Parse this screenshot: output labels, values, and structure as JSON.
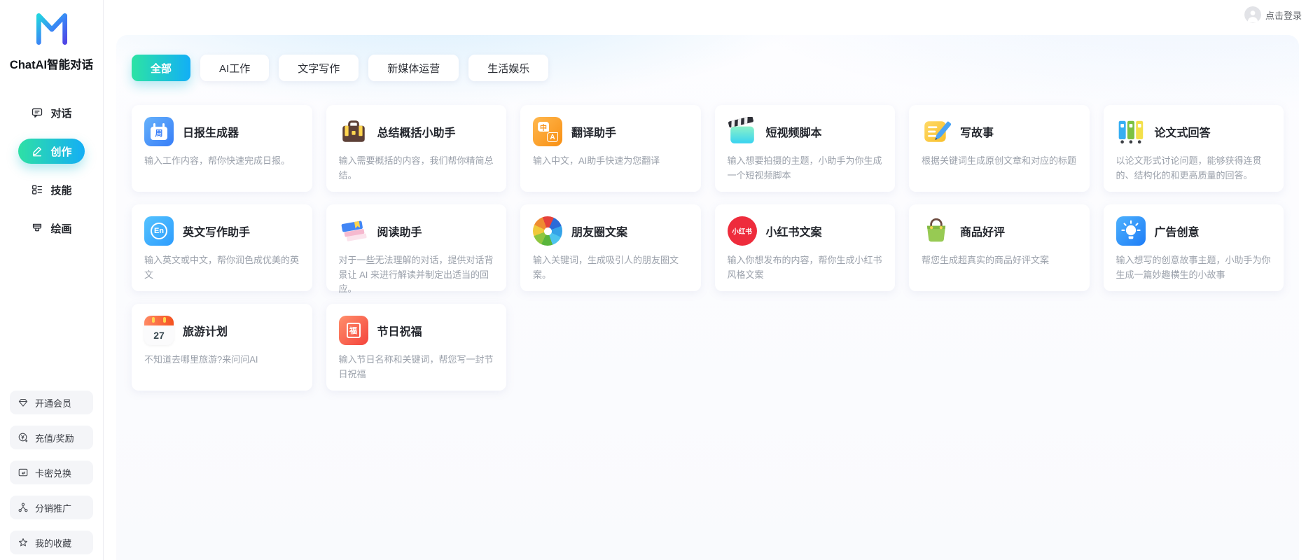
{
  "app": {
    "name": "ChatAI智能对话"
  },
  "header": {
    "login": "点击登录"
  },
  "sidebar": {
    "nav": [
      {
        "label": "对话",
        "active": false
      },
      {
        "label": "创作",
        "active": true
      },
      {
        "label": "技能",
        "active": false
      },
      {
        "label": "绘画",
        "active": false
      }
    ],
    "footer": [
      {
        "label": "开通会员"
      },
      {
        "label": "充值/奖励"
      },
      {
        "label": "卡密兑换"
      },
      {
        "label": "分销推广"
      },
      {
        "label": "我的收藏"
      }
    ]
  },
  "tabs": [
    {
      "label": "全部",
      "active": true
    },
    {
      "label": "AI工作",
      "active": false
    },
    {
      "label": "文字写作",
      "active": false
    },
    {
      "label": "新媒体运营",
      "active": false
    },
    {
      "label": "生活娱乐",
      "active": false
    }
  ],
  "cards": [
    {
      "title": "日报生成器",
      "desc": "输入工作内容，帮你快速完成日报。",
      "icon": "daily-report-icon"
    },
    {
      "title": "总结概括小助手",
      "desc": "输入需要概括的内容，我们帮你精简总结。",
      "icon": "briefcase-icon"
    },
    {
      "title": "翻译助手",
      "desc": "输入中文，AI助手快速为您翻译",
      "icon": "translate-icon"
    },
    {
      "title": "短视频脚本",
      "desc": "输入想要拍摄的主题，小助手为你生成一个短视频脚本",
      "icon": "clapperboard-icon"
    },
    {
      "title": "写故事",
      "desc": "根据关键词生成原创文章和对应的标题",
      "icon": "story-note-icon"
    },
    {
      "title": "论文式回答",
      "desc": "以论文形式讨论问题，能够获得连贯的、结构化的和更高质量的回答。",
      "icon": "binders-icon"
    },
    {
      "title": "英文写作助手",
      "desc": "输入英文或中文，帮你润色成优美的英文",
      "icon": "english-icon"
    },
    {
      "title": "阅读助手",
      "desc": "对于一些无法理解的对话，提供对话背景让 AI 来进行解读并制定出适当的回应。",
      "icon": "books-icon"
    },
    {
      "title": "朋友圈文案",
      "desc": "输入关键词，生成吸引人的朋友圈文案。",
      "icon": "moments-icon"
    },
    {
      "title": "小红书文案",
      "desc": "输入你想发布的内容，帮你生成小红书风格文案",
      "icon": "xiaohongshu-icon"
    },
    {
      "title": "商品好评",
      "desc": "帮您生成超真实的商品好评文案",
      "icon": "shopping-bag-icon"
    },
    {
      "title": "广告创意",
      "desc": "输入想写的创意故事主题，小助手为你生成一篇妙趣横生的小故事",
      "icon": "lightbulb-icon"
    },
    {
      "title": "旅游计划",
      "desc": "不知道去哪里旅游?来问问AI",
      "icon": "travel-calendar-icon"
    },
    {
      "title": "节日祝福",
      "desc": "输入节日名称和关键词，帮您写一封节日祝福",
      "icon": "festival-icon"
    }
  ],
  "icon_glyphs": {
    "daily": "周",
    "translate_zh": "中",
    "translate_en": "A",
    "english": "En",
    "xiaohongshu": "小红书",
    "travel_day": "27",
    "festival": "福"
  },
  "colors": {
    "accent_gradient_start": "#2ee0a5",
    "accent_gradient_end": "#14aef5",
    "xiaohongshu_red": "#ee2c3c"
  }
}
